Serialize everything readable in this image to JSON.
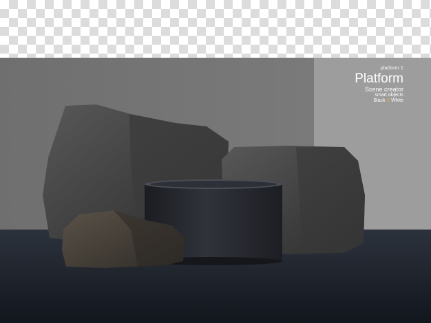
{
  "label_small": "platform 1",
  "title": "Platform",
  "subtitle": "Scene creator",
  "line3": "smart objects",
  "line4_black": "Black",
  "line4_amp": "&",
  "line4_white": "White",
  "colors": {
    "wall_left": "#757575",
    "wall_right": "#9e9e9e",
    "floor": "#1e232c",
    "podium": "#25272d",
    "rock": "#4a4a4a",
    "amp_accent": "#e8a33a"
  }
}
